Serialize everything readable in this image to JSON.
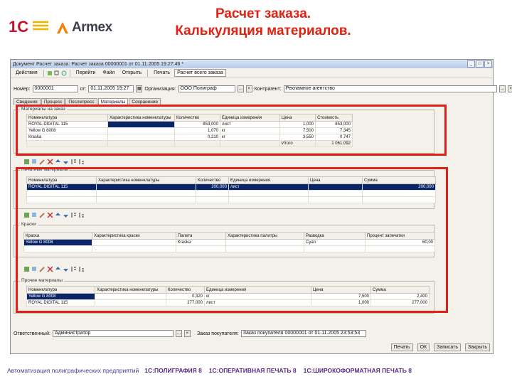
{
  "slide": {
    "title_line1": "Расчет заказа.",
    "title_line2": "Калькуляция материалов.",
    "logo_1c_text": "1С",
    "logo_armex_text": "Armex"
  },
  "window": {
    "title": "Документ Расчет заказа: Расчет заказа 00000001 от 01.11.2005 19:27:46 *",
    "menu": [
      "Действия",
      "Перейти",
      "Файл",
      "Открыть",
      "Печать",
      "Расчет всего заказа"
    ],
    "number_label": "Номер:",
    "number_value": "0000001",
    "date_label": "от:",
    "date_value": "01.11.2005 19:27",
    "org_label": "Организация:",
    "org_value": "ООО Полиграф",
    "contractor_label": "Контрагент:",
    "contractor_value": "Рекламное агентство",
    "tabs": [
      "Сведения",
      "Процесс",
      "Послепресс",
      "Материалы",
      "Сохранение"
    ]
  },
  "materials_order": {
    "label": "Материалы на заказ",
    "columns": [
      "Номенклатура",
      "Характеристика номенклатуры",
      "Количество",
      "Единица измерения",
      "Цена",
      "Стоимость"
    ],
    "rows": [
      [
        "ROYAL DIGITAL 115",
        "",
        "853,000",
        "лист",
        "1,000",
        "853,000"
      ],
      [
        "Yellow G 8008",
        "",
        "1,070",
        "кг",
        "7,500",
        "7,345"
      ],
      [
        "Кraska",
        "",
        "0,210",
        "кг",
        "3,550",
        "0,747"
      ]
    ],
    "total_label": "Итого",
    "total_value": "1 061,092"
  },
  "printed": {
    "label": "Печатные материалы",
    "columns": [
      "Номенклатура",
      "Характеристика номенклатуры",
      "Количество",
      "Единица измерения",
      "Цена",
      "Сумма"
    ],
    "rows": [
      [
        "ROYAL DIGITAL 115",
        "",
        "200,000",
        "лист",
        "",
        "200,000"
      ]
    ]
  },
  "paints": {
    "label": "Краски",
    "columns": [
      "Краска",
      "Характеристика краски",
      "Палета",
      "Характеристика палитры",
      "Разводка",
      "Процент запечатки"
    ],
    "rows": [
      [
        "Yellow G 8008",
        "",
        "Кraska",
        "",
        "Cyan",
        "60,00"
      ]
    ]
  },
  "other": {
    "label": "Прочие материалы",
    "columns": [
      "Номенклатура",
      "Характеристика номенклатуры",
      "Количество",
      "Единица измерения",
      "Цена",
      "Сумма"
    ],
    "rows": [
      [
        "Yellow G 8008",
        "",
        "0,320",
        "кг",
        "7,500",
        "2,400"
      ],
      [
        "ROYAL DIGITAL 115",
        "",
        "277,000",
        "лист",
        "1,000",
        "277,000"
      ]
    ]
  },
  "status": {
    "responsible_label": "Ответственный:",
    "responsible_value": "Администратор",
    "basis_label": "Заказ покупателя:",
    "basis_value": "Заказ покупателя 00000001 от 01.11.2005 23:53:53"
  },
  "bottom_buttons": [
    "Печать",
    "ОК",
    "Записать",
    "Закрыть"
  ],
  "footer": {
    "left": "Автоматизация полиграфических предприятий",
    "p1": "1С:ПОЛИГРАФИЯ 8",
    "p2": "1С:ОПЕРАТИВНАЯ ПЕЧАТЬ 8",
    "p3": "1С:ШИРОКОФОРМАТНАЯ ПЕЧАТЬ 8"
  },
  "colors": {
    "title_red": "#e02010",
    "selection": "#0a246a",
    "footer_purple": "#5a2a82"
  }
}
